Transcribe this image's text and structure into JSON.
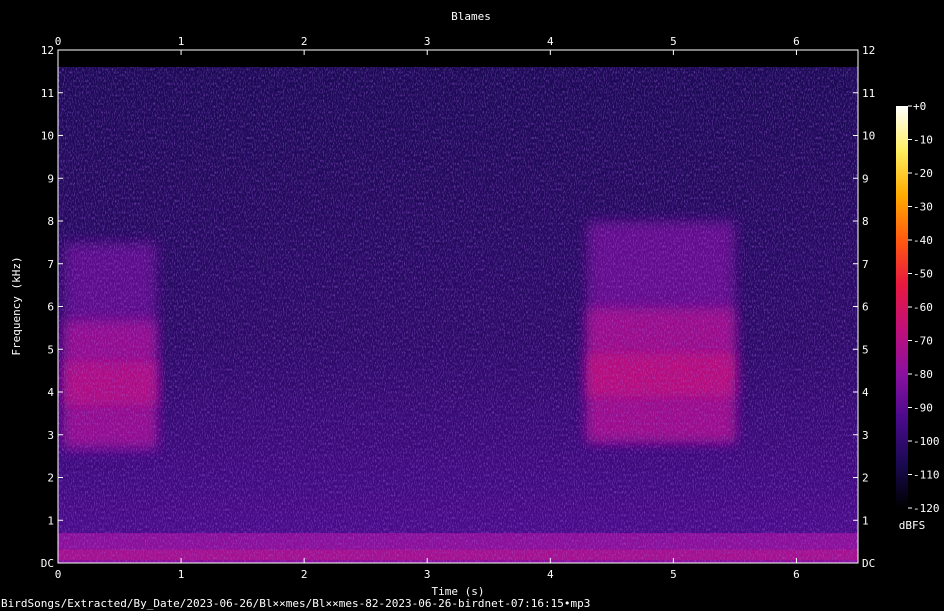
{
  "chart_data": {
    "type": "heatmap",
    "title": "Blames",
    "xlabel": "Time (s)",
    "ylabel": "Frequency (kHz)",
    "xlim": [
      0,
      6.5
    ],
    "ylim": [
      0,
      12
    ],
    "x_ticks": [
      "0",
      "1",
      "2",
      "3",
      "4",
      "5",
      "6"
    ],
    "y_ticks": [
      "DC",
      "1",
      "2",
      "3",
      "4",
      "5",
      "6",
      "7",
      "8",
      "9",
      "10",
      "11",
      "12"
    ],
    "colorbar": {
      "label": "dBFS",
      "ticks": [
        "+0",
        "-10",
        "-20",
        "-30",
        "-40",
        "-50",
        "-60",
        "-70",
        "-80",
        "-90",
        "-100",
        "-110",
        "-120"
      ],
      "range": [
        -120,
        0
      ],
      "colors": [
        "#000000",
        "#1a0a52",
        "#4a0a8c",
        "#8a10a0",
        "#c0107a",
        "#e81840",
        "#ff5a10",
        "#ffaa00",
        "#ffee60",
        "#ffffff"
      ]
    },
    "signal_top_khz": 11.6,
    "bursts": [
      {
        "t_start": 0.05,
        "t_end": 0.8,
        "f_low": 2.6,
        "f_high": 7.5,
        "peak_khz": 4.2,
        "level_dbfs": -68
      },
      {
        "t_start": 4.3,
        "t_end": 5.5,
        "f_low": 2.8,
        "f_high": 8.0,
        "peak_khz": 4.4,
        "level_dbfs": -66
      }
    ],
    "low_band": {
      "f_high": 0.7,
      "level_dbfs": -78
    },
    "background_dbfs": -102
  },
  "footer": {
    "file_path": "BirdSongs/Extracted/By_Date/2023-06-26/Bl××mes/Bl××mes-82-2023-06-26-birdnet-07:16:15•mp3"
  }
}
